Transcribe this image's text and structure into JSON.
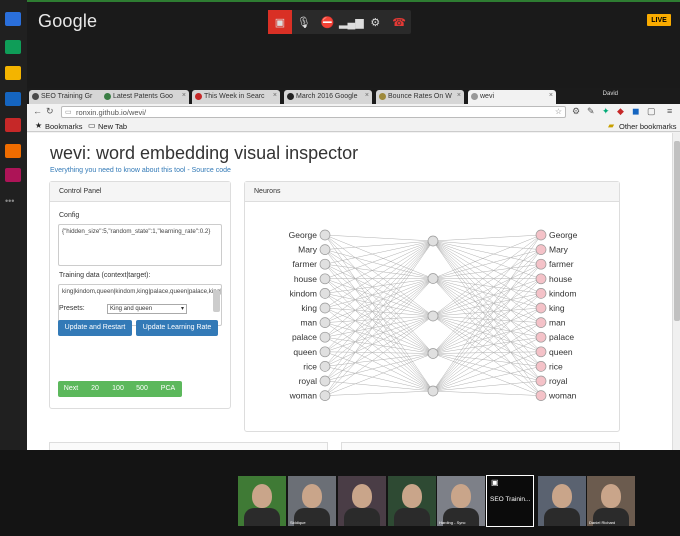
{
  "hangouts": {
    "brand": "Google",
    "live_badge": "LIVE"
  },
  "browser": {
    "tabs": [
      {
        "label": "SEO Training Gr",
        "color": "#4a4a4a"
      },
      {
        "label": "Latest Patents Goo",
        "color": "#3a7d44"
      },
      {
        "label": "This Week in Searc",
        "color": "#c62828"
      },
      {
        "label": "March 2016 Google",
        "color": "#222"
      },
      {
        "label": "Bounce Rates On W",
        "color": "#9e8a3c"
      },
      {
        "label": "wevi",
        "color": "#999"
      }
    ],
    "profile_name": "David",
    "url": "ronxin.github.io/wevi/",
    "bookmarks_label": "Bookmarks",
    "new_tab_label": "New Tab",
    "other_bookmarks_label": "Other bookmarks"
  },
  "page": {
    "title": "wevi: word embedding visual inspector",
    "subtitle": "Everything you need to know about this tool - Source code",
    "control_panel": {
      "heading": "Control Panel",
      "config_label": "Config",
      "config_value": "{\"hidden_size\":5,\"random_state\":1,\"learning_rate\":0.2}",
      "training_label": "Training data (context|target):",
      "training_value": "king|kindom,queen|kindom,king|palace,queen|palace,king|royal,queen|royal,king|George,queen|Mary,man|rice,woman|rice,man|farmer,woman|farmer,man|house,woman|house,man|George,",
      "presets_label": "Presets:",
      "preset_selected": "King and queen",
      "update_restart": "Update and Restart",
      "update_lr": "Update Learning Rate",
      "green_buttons": [
        "Next",
        "20",
        "100",
        "500",
        "PCA"
      ]
    },
    "neurons_panel": {
      "heading": "Neurons",
      "input_words": [
        "George",
        "Mary",
        "farmer",
        "house",
        "kindom",
        "king",
        "man",
        "palace",
        "queen",
        "rice",
        "royal",
        "woman"
      ],
      "output_words": [
        "George",
        "Mary",
        "farmer",
        "house",
        "kindom",
        "king",
        "man",
        "palace",
        "queen",
        "rice",
        "royal",
        "woman"
      ],
      "hidden_count": 5
    }
  },
  "participants": [
    {
      "name": "",
      "bg": "#3f7a35"
    },
    {
      "name": "Siddique",
      "bg": "#6b6f76"
    },
    {
      "name": "",
      "bg": "#4a3d46"
    },
    {
      "name": "",
      "bg": "#2e4a33"
    },
    {
      "name": "Harding - Sync",
      "bg": "#7d8088"
    },
    {
      "name": "SEO Trainin...",
      "bg": "#0b0b0b"
    },
    {
      "name": "",
      "bg": "#5a6270"
    },
    {
      "name": "Daniel Richard",
      "bg": "#6b5b4e"
    }
  ]
}
